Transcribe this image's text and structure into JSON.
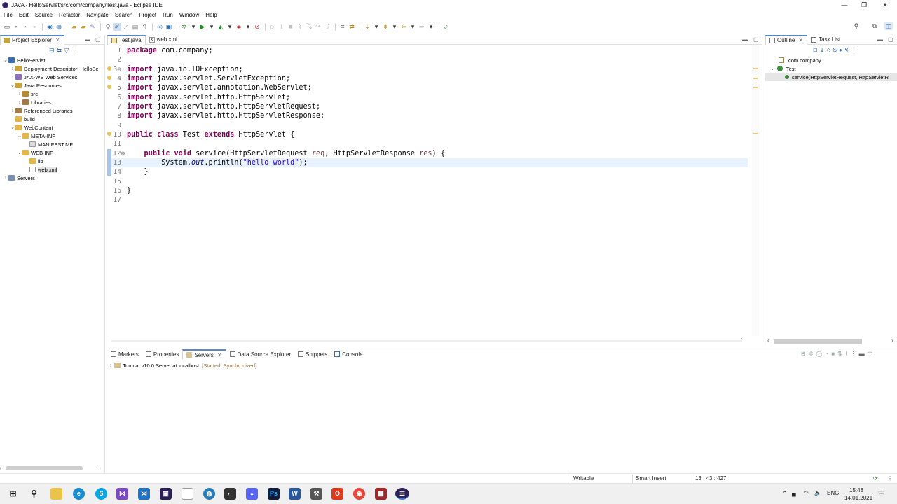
{
  "window": {
    "title": "JAVA - HelloServlet/src/com/company/Test.java - Eclipse IDE",
    "minimize": "—",
    "maximize": "❐",
    "close": "✕"
  },
  "menu": [
    "File",
    "Edit",
    "Source",
    "Refactor",
    "Navigate",
    "Search",
    "Project",
    "Run",
    "Window",
    "Help"
  ],
  "explorer": {
    "tab_label": "Project Explorer",
    "tree": [
      {
        "label": "HelloServlet",
        "depth": 0,
        "twisty": "⌄",
        "icon": "project"
      },
      {
        "label": "Deployment Descriptor: HelloSe",
        "depth": 1,
        "twisty": "›",
        "icon": "descriptor"
      },
      {
        "label": "JAX-WS Web Services",
        "depth": 1,
        "twisty": "›",
        "icon": "service"
      },
      {
        "label": "Java Resources",
        "depth": 1,
        "twisty": "⌄",
        "icon": "java-res"
      },
      {
        "label": "src",
        "depth": 2,
        "twisty": "›",
        "icon": "package-folder"
      },
      {
        "label": "Libraries",
        "depth": 2,
        "twisty": "›",
        "icon": "library"
      },
      {
        "label": "Referenced Libraries",
        "depth": 1,
        "twisty": "›",
        "icon": "library"
      },
      {
        "label": "build",
        "depth": 1,
        "twisty": "",
        "icon": "folder"
      },
      {
        "label": "WebContent",
        "depth": 1,
        "twisty": "⌄",
        "icon": "folder"
      },
      {
        "label": "META-INF",
        "depth": 2,
        "twisty": "⌄",
        "icon": "folder"
      },
      {
        "label": "MANIFEST.MF",
        "depth": 3,
        "twisty": "",
        "icon": "file"
      },
      {
        "label": "WEB-INF",
        "depth": 2,
        "twisty": "⌄",
        "icon": "folder"
      },
      {
        "label": "lib",
        "depth": 3,
        "twisty": "",
        "icon": "folder"
      },
      {
        "label": "web.xml",
        "depth": 3,
        "twisty": "",
        "icon": "xml",
        "selected": true
      },
      {
        "label": "Servers",
        "depth": 0,
        "twisty": "›",
        "icon": "servers"
      }
    ]
  },
  "editor": {
    "tabs": [
      {
        "label": "Test.java",
        "active": true,
        "icon": "java-file"
      },
      {
        "label": "web.xml",
        "active": false,
        "icon": "xml-file"
      }
    ],
    "line_numbers": [
      "1",
      "2",
      "3⊖",
      "4",
      "5",
      "6",
      "7",
      "8",
      "9",
      "10",
      "11",
      "12⊖",
      "13",
      "14",
      "15",
      "16",
      "17"
    ],
    "current_line_index": 12
  },
  "outline": {
    "tabs": [
      "Outline",
      "Task List"
    ],
    "items": [
      {
        "label": "com.company",
        "icon": "package"
      },
      {
        "label": "Test",
        "icon": "class"
      },
      {
        "label": "service(HttpServletRequest, HttpServletR",
        "icon": "method"
      }
    ]
  },
  "bottom": {
    "tabs": [
      "Markers",
      "Properties",
      "Servers",
      "Data Source Explorer",
      "Snippets",
      "Console"
    ],
    "active_tab": "Servers",
    "server_name": "Tomcat v10.0 Server at localhost",
    "server_state": "[Started, Synchronized]"
  },
  "status": {
    "writable": "Writable",
    "insert_mode": "Smart Insert",
    "position": "13 : 43 : 427"
  },
  "taskbar": {
    "lang": "ENG",
    "time": "15:48",
    "date": "14.01.2021"
  },
  "colors": {
    "keyword": "#7f0055",
    "string": "#2a00ff",
    "static_field": "#0000c0",
    "parameter": "#6a3e3e",
    "current_line": "#e8f2fe",
    "server_state": "#8b6f47"
  }
}
